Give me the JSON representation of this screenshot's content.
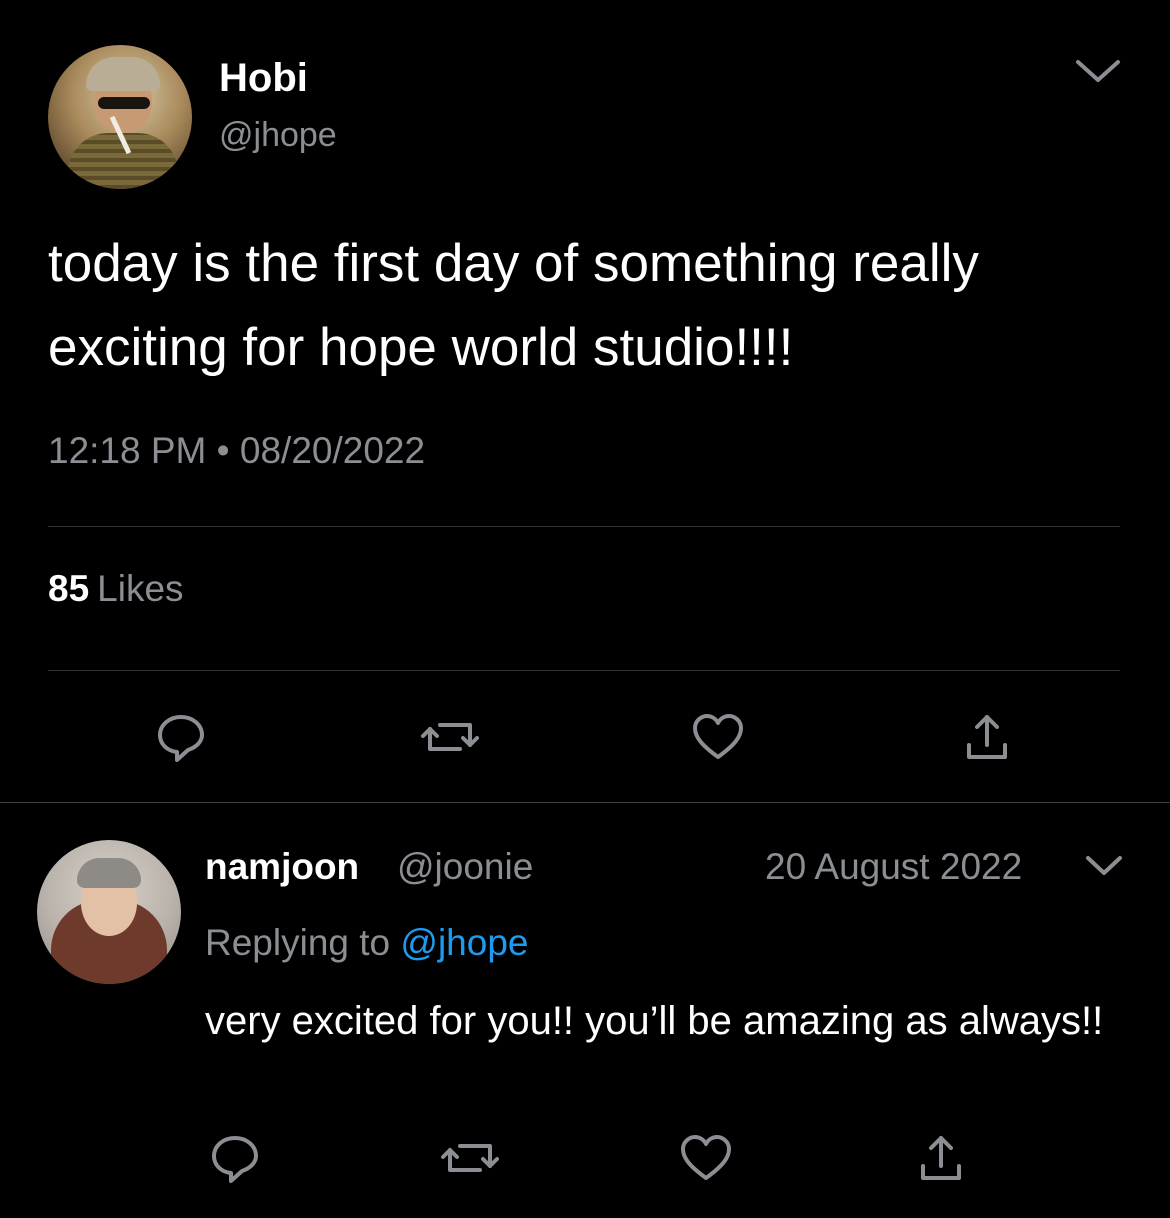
{
  "main_tweet": {
    "display_name": "Hobi",
    "handle": "@jhope",
    "text": "today is the first day of something really exciting for hope world studio!!!!",
    "time": "12:18 PM",
    "separator": "•",
    "date": "08/20/2022",
    "likes_count": "85",
    "likes_label": "Likes",
    "actions": [
      "reply-icon",
      "retweet-icon",
      "like-icon",
      "share-icon"
    ]
  },
  "reply_tweet": {
    "display_name": "namjoon",
    "handle": "@joonie",
    "date": "20 August 2022",
    "replying_prefix": "Replying to",
    "replying_mention": "@jhope",
    "text": "very excited for you!! you’ll be amazing as always!!",
    "actions": [
      "reply-icon",
      "retweet-icon",
      "like-icon",
      "share-icon"
    ]
  },
  "colors": {
    "background": "#000000",
    "primary_text": "#ffffff",
    "secondary_text": "#8b8f94",
    "divider": "#2f3336",
    "mention": "#1d9bf0",
    "icon": "#8b8f94"
  }
}
